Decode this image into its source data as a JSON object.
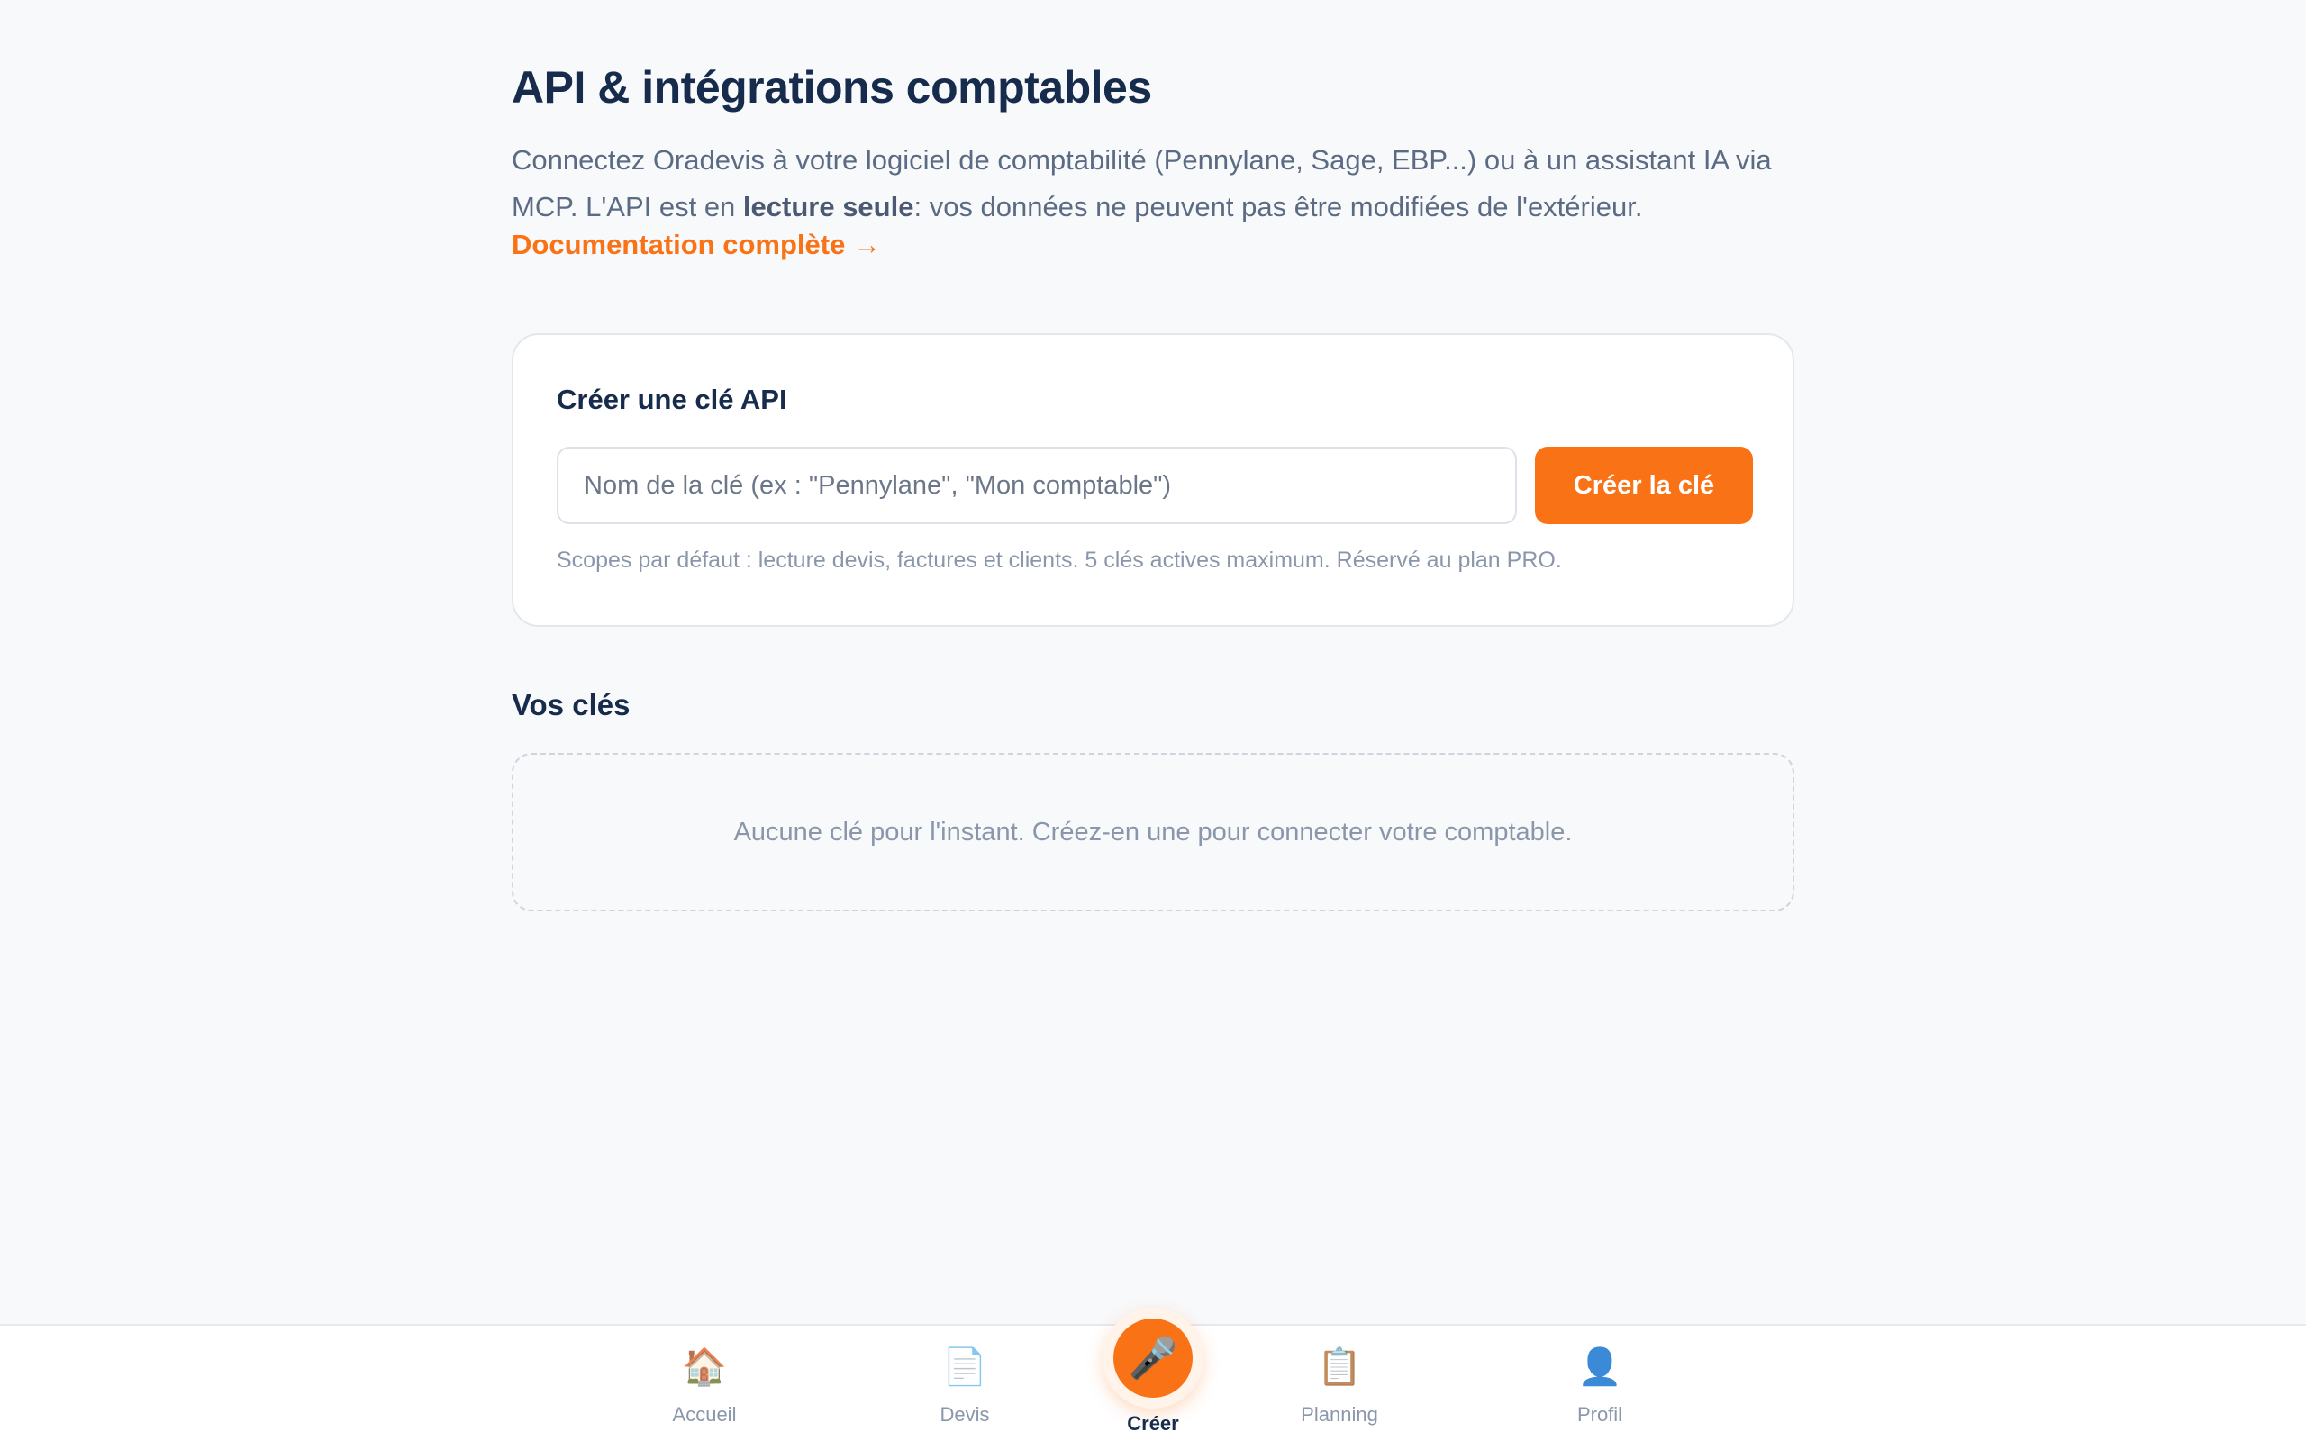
{
  "page": {
    "title": "API & intégrations comptables",
    "intro_part1": "Connectez Oradevis à votre logiciel de comptabilité (Pennylane, Sage, EBP...) ou à un assistant IA via MCP. L'API est en ",
    "intro_bold": "lecture seule",
    "intro_part2": ": vos données ne peuvent pas être modifiées de l'extérieur.",
    "doc_link": "Documentation complète →"
  },
  "create_card": {
    "title": "Créer une clé API",
    "input_placeholder": "Nom de la clé (ex : \"Pennylane\", \"Mon comptable\")",
    "input_value": "",
    "button_label": "Créer la clé",
    "hint": "Scopes par défaut : lecture devis, factures et clients. 5 clés actives maximum. Réservé au plan PRO."
  },
  "keys": {
    "title": "Vos clés",
    "empty_text": "Aucune clé pour l'instant. Créez-en une pour connecter votre comptable."
  },
  "nav": {
    "items": [
      {
        "label": "Accueil",
        "icon": "🏠",
        "icon_name": "home-icon"
      },
      {
        "label": "Devis",
        "icon": "📄",
        "icon_name": "document-icon"
      },
      {
        "label": "Créer",
        "icon": "🎤",
        "icon_name": "microphone-icon"
      },
      {
        "label": "Planning",
        "icon": "📋",
        "icon_name": "clipboard-icon"
      },
      {
        "label": "Profil",
        "icon": "👤",
        "icon_name": "user-icon"
      }
    ],
    "active": "Créer"
  },
  "colors": {
    "accent": "#f97316",
    "title": "#172b4d",
    "muted": "#8a97ab",
    "background": "#f8f9fb"
  }
}
